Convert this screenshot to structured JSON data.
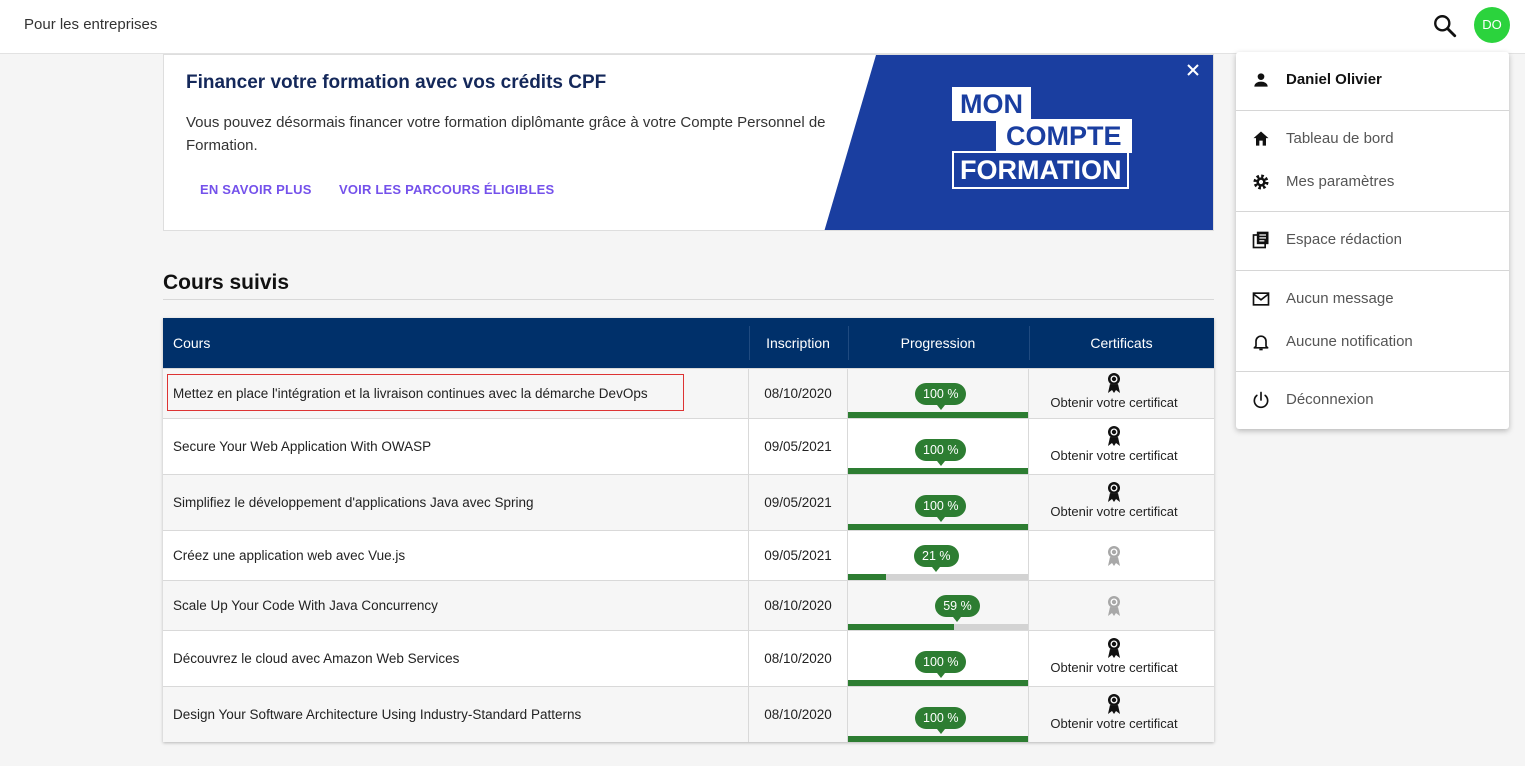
{
  "topbar": {
    "business_link": "Pour les entreprises",
    "avatar_initials": "DO",
    "avatar_color": "#2bd33d"
  },
  "banner": {
    "title": "Financer votre formation avec vos crédits CPF",
    "description": "Vous pouvez désormais financer votre formation diplômante grâce à votre Compte Personnel de Formation.",
    "link_more": "EN SAVOIR PLUS",
    "link_paths": "VOIR LES PARCOURS ÉLIGIBLES",
    "close_icon": "close-icon",
    "logo_line1": "MON",
    "logo_line2": "COMPTE",
    "logo_line3": "FORMATION",
    "brand_color": "#1a3ea0"
  },
  "section": {
    "title": "Cours suivis"
  },
  "table": {
    "headers": {
      "course": "Cours",
      "date": "Inscription",
      "progress": "Progression",
      "certs": "Certificats"
    },
    "rows": [
      {
        "name": "Mettez en place l'intégration et la livraison continues avec la démarche DevOps",
        "date": "08/10/2020",
        "progress": "100 %",
        "pct": 100,
        "cert": "Obtenir votre certificat",
        "has_cert": true
      },
      {
        "name": "Secure Your Web Application With OWASP",
        "date": "09/05/2021",
        "progress": "100 %",
        "pct": 100,
        "cert": "Obtenir votre certificat",
        "has_cert": true
      },
      {
        "name": "Simplifiez le développement d'applications Java avec Spring",
        "date": "09/05/2021",
        "progress": "100 %",
        "pct": 100,
        "cert": "Obtenir votre certificat",
        "has_cert": true
      },
      {
        "name": "Créez une application web avec Vue.js",
        "date": "09/05/2021",
        "progress": "21 %",
        "pct": 21,
        "cert": "",
        "has_cert": false
      },
      {
        "name": "Scale Up Your Code With Java Concurrency",
        "date": "08/10/2020",
        "progress": "59 %",
        "pct": 59,
        "cert": "",
        "has_cert": false
      },
      {
        "name": "Découvrez le cloud avec Amazon Web Services",
        "date": "08/10/2020",
        "progress": "100 %",
        "pct": 100,
        "cert": "Obtenir votre certificat",
        "has_cert": true
      },
      {
        "name": "Design Your Software Architecture Using Industry-Standard Patterns",
        "date": "08/10/2020",
        "progress": "100 %",
        "pct": 100,
        "cert": "Obtenir votre certificat",
        "has_cert": true
      }
    ],
    "header_color": "#00306a",
    "progress_color": "#2d7d32"
  },
  "menu": {
    "user_name": "Daniel Olivier",
    "dashboard": "Tableau de bord",
    "settings": "Mes paramètres",
    "editorial": "Espace rédaction",
    "messages": "Aucun message",
    "notifications": "Aucune notification",
    "logout": "Déconnexion"
  }
}
